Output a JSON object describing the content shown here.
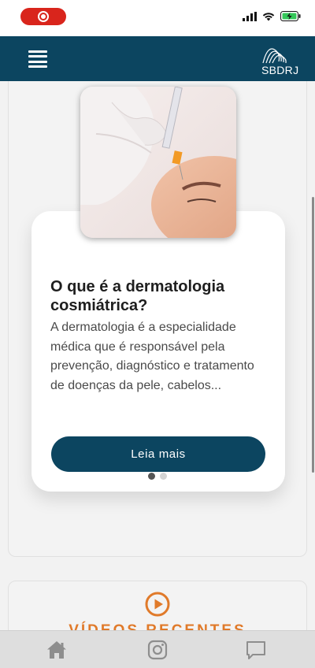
{
  "status_bar": {
    "record_indicator": "screen-record-icon",
    "icons": [
      "signal-icon",
      "wifi-icon",
      "battery-charging-icon"
    ]
  },
  "header": {
    "menu_icon": "hamburger-menu-icon",
    "logo_text": "SBDRJ"
  },
  "article_card": {
    "image_alt": "cosmetic dermatology procedure photo",
    "title": "O que é a dermatologia cosmiátrica?",
    "excerpt": "A dermatologia é a especialidade médica que é responsável pela prevenção, diagnóstico e tratamento de doenças da pele, cabelos...",
    "button_label": "Leia mais",
    "carousel": {
      "count": 2,
      "active_index": 0
    }
  },
  "videos_section": {
    "icon": "play-circle-icon",
    "title": "VÍDEOS RECENTES"
  },
  "tab_bar": {
    "items": [
      {
        "icon": "home-icon"
      },
      {
        "icon": "instagram-icon"
      },
      {
        "icon": "chat-bubble-icon"
      }
    ]
  },
  "colors": {
    "primary": "#0c4560",
    "accent": "#e07a2a",
    "record_red": "#d9251c"
  }
}
